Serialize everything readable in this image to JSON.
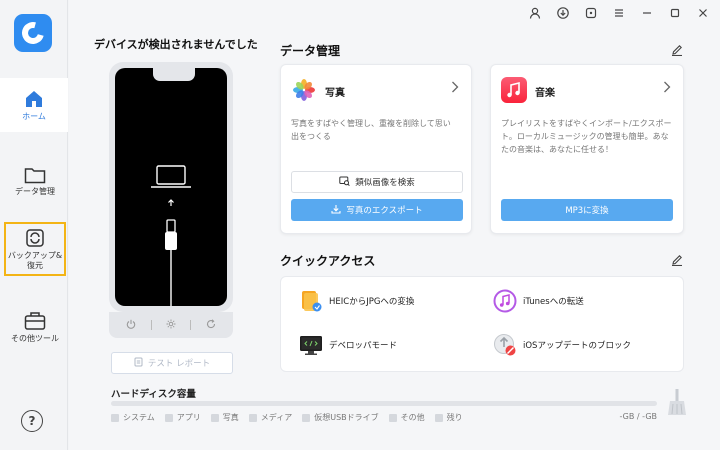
{
  "sidebar": {
    "items": [
      {
        "label": "ホーム"
      },
      {
        "label": "データ管理"
      },
      {
        "label": "バックアップ&\n復元"
      },
      {
        "label": "その他ツール"
      }
    ],
    "help": "?"
  },
  "device": {
    "title": "デバイスが検出されませんでした",
    "test_report": "テスト レポート"
  },
  "disk": {
    "title": "ハードディスク容量",
    "legend": [
      "システム",
      "アプリ",
      "写真",
      "メディア",
      "仮想USBドライブ",
      "その他",
      "残り"
    ],
    "value": "-GB / -GB"
  },
  "data_mgmt": {
    "title": "データ管理",
    "photos": {
      "name": "写真",
      "desc": "写真をすばやく管理し、重複を削除して思い出をつくる",
      "btn_similar": "類似画像を検索",
      "btn_export": "写真のエクスポート"
    },
    "music": {
      "name": "音楽",
      "desc": "プレイリストをすばやくインポート/エクスポート。ローカルミュージックの管理も簡単。あなたの音楽は、あなたに任せる！",
      "btn_mp3": "MP3に変換"
    }
  },
  "quick": {
    "title": "クイックアクセス",
    "items": [
      {
        "label": "HEICからJPGへの変換"
      },
      {
        "label": "iTunesへの転送"
      },
      {
        "label": "デベロッパモード"
      },
      {
        "label": "iOSアップデートのブロック"
      }
    ]
  },
  "colors": {
    "accent": "#58a9f0",
    "brand": "#2f8cf0",
    "highlight": "#f3b415"
  }
}
